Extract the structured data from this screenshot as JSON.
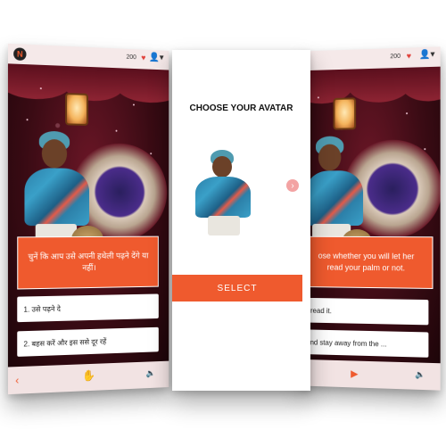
{
  "left_screen": {
    "coins": "200",
    "question": "चुनें कि आप उसे अपनी हथेली पढ़ने देंगे या नहीं।",
    "options": [
      "1. उसे पढ़ने दे",
      "2. बहस करें और इस ससे दूर रहें"
    ]
  },
  "center_screen": {
    "title": "CHOOSE YOUR AVATAR",
    "select_label": "SELECT"
  },
  "right_screen": {
    "coins": "200",
    "question_line1": "ose whether you will let her",
    "question_line2": "read your palm or not.",
    "options": [
      "r read it.",
      "and stay away from the ..."
    ]
  },
  "icons": {
    "logo": "logo-icon",
    "heart": "heart-icon",
    "user": "user-icon",
    "back": "chevron-left-icon",
    "hand": "hand-icon",
    "sound": "speaker-icon",
    "play": "play-icon",
    "next": "chevron-right-icon"
  },
  "colors": {
    "accent": "#ef5a2e",
    "heart": "#e0403a"
  }
}
